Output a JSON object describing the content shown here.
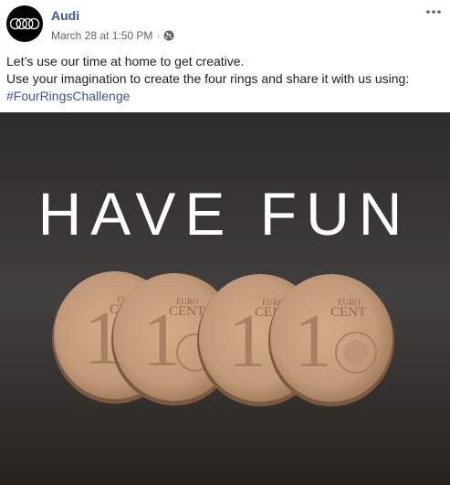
{
  "post": {
    "author": "Audi",
    "timestamp": "March 28 at 1:50 PM",
    "separator": "·",
    "privacy_icon": "globe-icon",
    "more_icon": "more-options-icon",
    "text_line_1": "Let’s use our time at home to get creative.",
    "text_line_2": "Use your imagination to create the four rings and share it with us using:",
    "hashtag": "#FourRingsChallenge"
  },
  "media": {
    "overlay_text": "HAVE FUN",
    "coin_value": "1",
    "coin_label_euro": "EURO",
    "coin_label_cent": "CENT",
    "colors": {
      "table": "#3b3a38",
      "coin": "#c29a79",
      "overlay_text": "#ffffff"
    }
  },
  "colors": {
    "link": "#385898",
    "meta": "#616770",
    "text": "#1c1e21"
  }
}
